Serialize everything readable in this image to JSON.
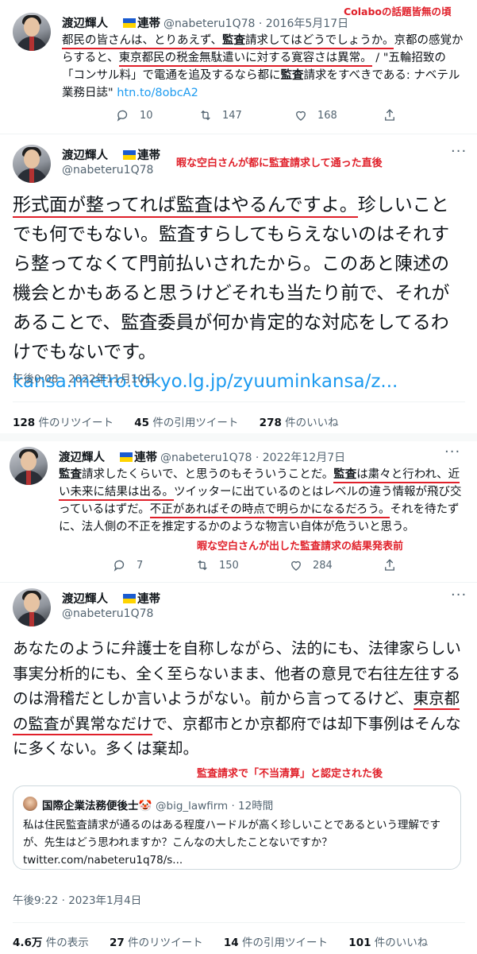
{
  "colors": {
    "annotation_red": "#e0202a",
    "link_blue": "#1d9bf0",
    "flag_blue": "#1a5bd0",
    "flag_yellow": "#ffd400"
  },
  "annotations": {
    "top_right": "Colaboの話題皆無の頃",
    "tweet2": "暇な空白さんが都に監査請求して通った直後",
    "tweet3": "暇な空白さんが出した監査請求の結果発表前",
    "tweet4": "監査請求で「不当清算」と認定された後"
  },
  "tweet1": {
    "name": "渡辺輝人",
    "flag_text": "連帯",
    "handle_date": "@nabeteru1Q78 · 2016年5月17日",
    "seg1": "都民の皆さんは、とりあえず、",
    "seg2": "監査",
    "seg3": "請求してはどうでしょうか。",
    "seg4": "京都の感覚からすると、",
    "seg5": "東京都民の税金無駄遣いに対する寛容さは異常。",
    "seg6": " / \"五輪招致の「コンサル料」で電通を追及するなら都に",
    "seg7": "監査",
    "seg8": "請求をすべきである: ナベテル業務日誌\" ",
    "link": "htn.to/8obcA2",
    "replies": "10",
    "retweets": "147",
    "likes": "168"
  },
  "tweet2": {
    "name": "渡辺輝人",
    "flag_text": "連帯",
    "handle": "@nabeteru1Q78",
    "seg1": "形式面が整ってれば監査はやるんですよ。",
    "seg2": "珍しいことでも何でもない。監査すらしてもらえないのはそれすら整ってなくて門前払いされたから。このあと陳述の機会とかもあると思うけどそれも当たり前で、それがあることで、監査委員が何か肯定的な対応をしてるわけでもないです。",
    "link": "kansa.metro.tokyo.lg.jp/zyuuminkansa/z...",
    "timestamp": "午後0:08 · 2022年11月10日",
    "rt_num": "128",
    "rt_label": "件のリツイート",
    "qt_num": "45",
    "qt_label": "件の引用ツイート",
    "like_num": "278",
    "like_label": "件のいいね"
  },
  "tweet3": {
    "name": "渡辺輝人",
    "flag_text": "連帯",
    "handle_date": "@nabeteru1Q78 · 2022年12月7日",
    "seg1": "監査",
    "seg2": "請求したくらいで、と思うのもそういうことだ。",
    "seg3": "監査",
    "seg4": "は粛々と行われ、近い未来に結果は出る。",
    "seg5": "ツイッターに出ているのとはレベルの違う情報が飛び交っているはずだ。",
    "seg6": "不正があればその時点で明らかになるだろう。",
    "seg7": "それを待たずに、法人側の不正を推定するかのような物言い自体が危ういと思う。",
    "replies": "7",
    "retweets": "150",
    "likes": "284"
  },
  "tweet4": {
    "name": "渡辺輝人",
    "flag_text": "連帯",
    "handle": "@nabeteru1Q78",
    "seg1": "あなたのように弁護士を自称しながら、法的にも、法律家らしい事実分析的にも、全く至らないまま、他者の意見で右往左往するのは滑稽だとしか言いようがない。前から言ってるけど、",
    "seg2": "東京都の監査が異常なだけ",
    "seg3": "で、京都市とか京都府では却下事例はそんなに多くない。多くは棄却。",
    "quote_name": "国際企業法務便後士🤡",
    "quote_handle": "@big_lawfirm · 12時間",
    "quote_text": "私は住民監査請求が通るのはある程度ハードルが高く珍しいことであるという理解ですが、先生はどう思われますか？こんなの大したことないですか？",
    "quote_link": "twitter.com/nabeteru1q78/s...",
    "timestamp": "午後9:22 · 2023年1月4日",
    "views_num": "4.6万",
    "views_label": "件の表示",
    "rt_num": "27",
    "rt_label": "件のリツイート",
    "qt_num": "14",
    "qt_label": "件の引用ツイート",
    "like_num": "101",
    "like_label": "件のいいね"
  },
  "icons": [
    "reply-icon",
    "retweet-icon",
    "like-icon",
    "share-icon",
    "more-icon",
    "ukraine-flag-icon"
  ]
}
